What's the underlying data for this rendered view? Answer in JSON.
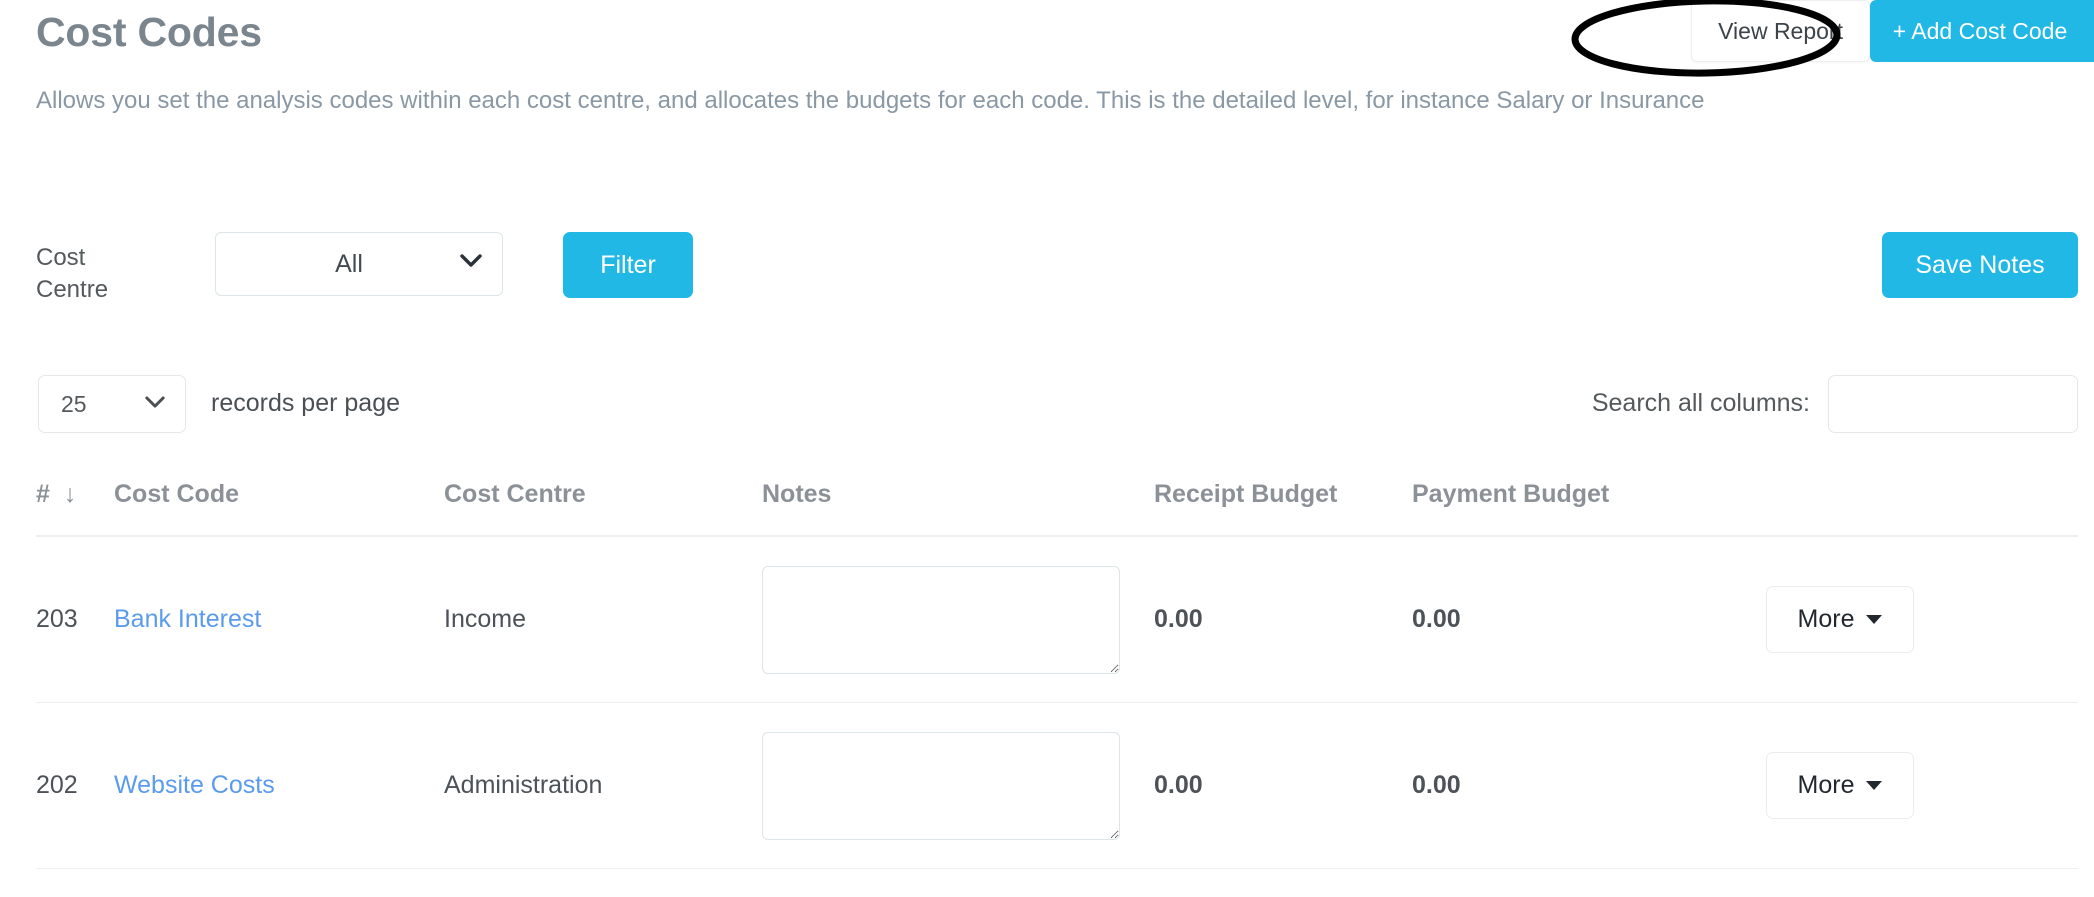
{
  "header": {
    "title": "Cost Codes",
    "subtitle": "Allows you set the analysis codes within each cost centre, and allocates the budgets for each code. This is the detailed level, for instance Salary or Insurance",
    "view_report_label": "View Report",
    "add_cost_code_label": "+ Add Cost Code"
  },
  "filters": {
    "cost_centre_label": "Cost Centre",
    "cost_centre_value": "All",
    "cost_centre_options": [
      "All"
    ],
    "filter_button_label": "Filter",
    "save_notes_label": "Save Notes"
  },
  "table_controls": {
    "records_per_page_value": "25",
    "records_per_page_options": [
      "25"
    ],
    "records_per_page_label": "records per page",
    "search_label": "Search all columns:",
    "search_value": "",
    "search_placeholder": ""
  },
  "table": {
    "columns": [
      {
        "key": "num",
        "label": "#",
        "sorted": "desc",
        "sort_glyph": "↓"
      },
      {
        "key": "code",
        "label": "Cost Code"
      },
      {
        "key": "centre",
        "label": "Cost Centre"
      },
      {
        "key": "notes",
        "label": "Notes"
      },
      {
        "key": "receipt",
        "label": "Receipt Budget"
      },
      {
        "key": "payment",
        "label": "Payment Budget"
      },
      {
        "key": "actions",
        "label": ""
      }
    ],
    "rows": [
      {
        "num": "203",
        "code": "Bank Interest",
        "centre": "Income",
        "notes": "",
        "receipt": "0.00",
        "payment": "0.00",
        "action_label": "More"
      },
      {
        "num": "202",
        "code": "Website Costs",
        "centre": "Administration",
        "notes": "",
        "receipt": "0.00",
        "payment": "0.00",
        "action_label": "More"
      }
    ]
  },
  "annotation": {
    "shape": "ellipse",
    "target": "view-report-button",
    "color": "#000000"
  },
  "colors": {
    "accent": "#22b8e6",
    "link": "#5a9bed",
    "title": "#7b858e",
    "subtitle": "#8a98a5",
    "header_text": "#8b9197",
    "divider": "#eceeef"
  }
}
